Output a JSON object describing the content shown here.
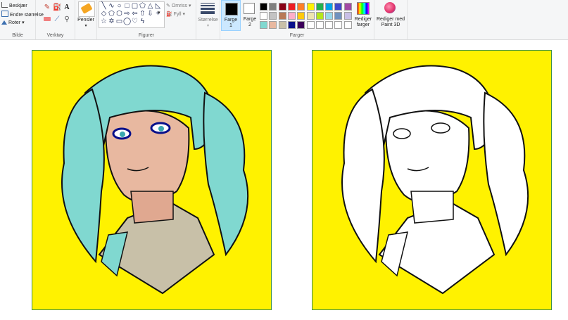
{
  "ribbon": {
    "image_group": {
      "label": "Bilde",
      "commands": [
        "Beskjær",
        "Endre størrelse",
        "Roter"
      ]
    },
    "tools_group": {
      "label": "Verktøy"
    },
    "brushes": {
      "label": "Pensler"
    },
    "shapes_group": {
      "label": "Figurer",
      "outline_label": "Omriss",
      "fill_label": "Fyll"
    },
    "size": {
      "label": "Størrelse"
    },
    "color1": {
      "label": "Farge 1",
      "color": "#000000"
    },
    "color2": {
      "label": "Farge 2",
      "color": "#ffffff"
    },
    "colors_group": {
      "label": "Farger"
    },
    "edit_colors": {
      "label": "Rediger farger"
    },
    "paint3d": {
      "label": "Rediger med Paint 3D"
    },
    "palette": [
      "#000000",
      "#7f7f7f",
      "#880015",
      "#ed1c24",
      "#ff7f27",
      "#fff200",
      "#22b14c",
      "#00a2e8",
      "#3f48cc",
      "#a349a4",
      "#ffffff",
      "#c3c3c3",
      "#b97a57",
      "#ffaec9",
      "#ffc90e",
      "#efe4b0",
      "#b5e61d",
      "#99d9ea",
      "#7092be",
      "#c8bfe7",
      "#80d8d0",
      "#e8b8a0",
      "#c8c0a8",
      "#08108a",
      "#3c005a",
      "#ffffff",
      "#ffffff",
      "#ffffff",
      "#ffffff",
      "#ffffff"
    ]
  },
  "canvas": {
    "background_color": "#fff200",
    "left_art": "colored-anime-portrait",
    "right_art": "lineart-anime-portrait"
  }
}
